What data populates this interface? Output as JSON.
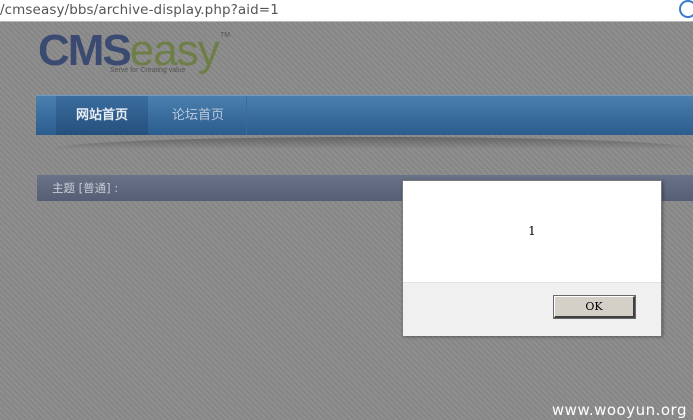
{
  "browser": {
    "url": "/cmseasy/bbs/archive-display.php?aid=1",
    "reload_icon": "reload-icon"
  },
  "logo": {
    "cms": "CMS",
    "easy": "easy",
    "tm": "TM",
    "tagline": "Serve for Creating value"
  },
  "nav": {
    "items": [
      {
        "label": "网站首页"
      },
      {
        "label": "论坛首页"
      }
    ]
  },
  "topic_bar": {
    "label": "主题 [普通] :"
  },
  "alert": {
    "message": "1",
    "ok_label": "OK"
  },
  "watermark": "www.wooyun.org"
}
